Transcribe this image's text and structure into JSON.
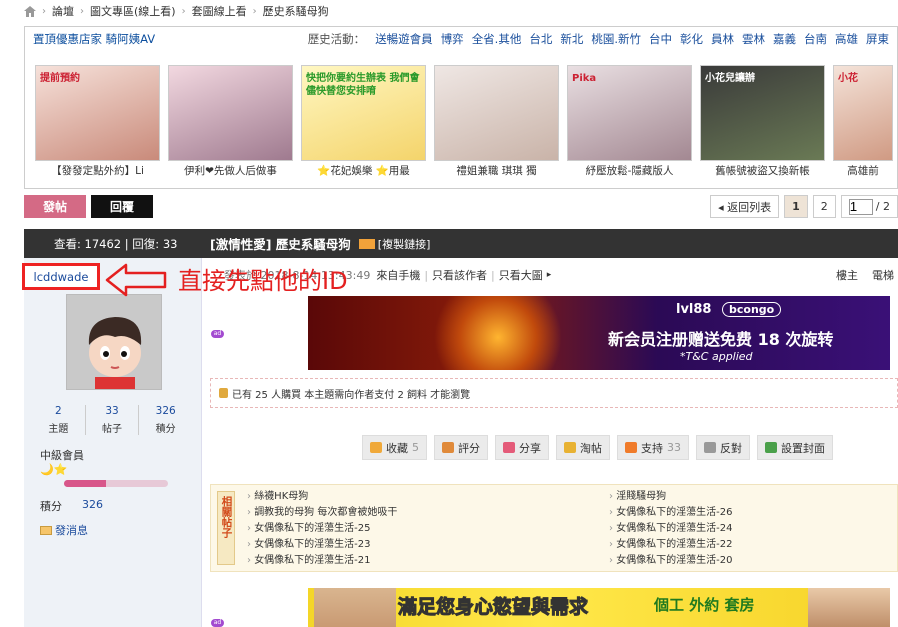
{
  "breadcrumb": {
    "items": [
      "論壇",
      "圖文專區(線上看)",
      "套圖線上看",
      "歷史系騷母狗"
    ]
  },
  "promo": {
    "left_label": "置頂優惠店家 騎阿姨AV",
    "activity_label": "歷史活動：",
    "links": [
      "送暢遊會員",
      "博弈",
      "全省.其他",
      "台北",
      "新北",
      "桃園.新竹",
      "台中",
      "彰化",
      "員林",
      "雲林",
      "嘉義",
      "台南",
      "高雄",
      "屏東"
    ],
    "thumbs": [
      {
        "caption": "【發發定點外約】Li",
        "img_text": "提前預約"
      },
      {
        "caption": "伊利❤先做人后做事",
        "img_text": ""
      },
      {
        "caption": "⭐花妃娛樂 ⭐用最",
        "img_text": "快把你要約生辦表 我們會儘快替您安排唷"
      },
      {
        "caption": "禮姐兼職 琪琪 獨",
        "img_text": ""
      },
      {
        "caption": "紓壓放鬆-隱藏版人",
        "img_text": "Pika"
      },
      {
        "caption": "舊帳號被盜又換新帳",
        "img_text": "小花兒讓辦"
      },
      {
        "caption": "高雄前",
        "img_text": "小花"
      }
    ]
  },
  "toolbar": {
    "post_label": "發帖",
    "reply_label": "回覆",
    "back_label": "◂ 返回列表",
    "pages": [
      "1",
      "2"
    ],
    "current_page": "1",
    "page_total": "/ 2"
  },
  "thread": {
    "stats": "查看: 17462 | 回復: 33",
    "title": "[激情性愛] 歷史系騷母狗",
    "copy_label": "[複製鏈接]"
  },
  "user": {
    "name": "lcddwade",
    "stats": [
      {
        "value": "2",
        "label": "主題"
      },
      {
        "value": "33",
        "label": "帖子"
      },
      {
        "value": "326",
        "label": "積分"
      }
    ],
    "level": "中級會員",
    "stars": "🌙⭐",
    "progress": 0.4,
    "points_label": "積分",
    "points_value": "326",
    "message_label": "發消息"
  },
  "annotation": {
    "text": "直接先點他的ID",
    "color": "#e42020"
  },
  "post_meta": {
    "hidden_text": "發表於 2018-8-14 13:43:49",
    "source": "來自手機",
    "only_author": "只看該作者",
    "only_image": "只看大圖",
    "floor_label": "樓主",
    "right_more": "電梯"
  },
  "banner1": {
    "logo": "lvl88",
    "logo_pill": "bcongo",
    "text": "新会员注册赠送免费 18 次旋转",
    "tc": "*T&C applied"
  },
  "purchase": {
    "text": "已有 25 人購買  本主題需向作者支付 2 飼料 才能瀏覽"
  },
  "actions": [
    {
      "icon": "star-icon",
      "label": "收藏",
      "count": "5",
      "color": "#f0a93a"
    },
    {
      "icon": "thumb-icon",
      "label": "評分",
      "count": "",
      "color": "#e08a3a"
    },
    {
      "icon": "heart-icon",
      "label": "分享",
      "count": "",
      "color": "#e45b79"
    },
    {
      "icon": "bucket-icon",
      "label": "淘帖",
      "count": "",
      "color": "#e8b233"
    },
    {
      "icon": "up-arrow-icon",
      "label": "支持",
      "count": "33",
      "color": "#f07b2a"
    },
    {
      "icon": "down-arrow-icon",
      "label": "反對",
      "count": "",
      "color": "#999999"
    },
    {
      "icon": "cover-icon",
      "label": "設置封面",
      "count": "",
      "color": "#4aa04a"
    }
  ],
  "related": {
    "tag": "相關帖子",
    "left": [
      "絲襪HK母狗",
      "調教我的母狗 每次都會被她吸干",
      "女偶像私下的淫蕩生活-25",
      "女偶像私下的淫蕩生活-23",
      "女偶像私下的淫蕩生活-21"
    ],
    "right": [
      "淫賤騷母狗",
      "女偶像私下的淫蕩生活-26",
      "女偶像私下的淫蕩生活-24",
      "女偶像私下的淫蕩生活-22",
      "女偶像私下的淫蕩生活-20"
    ]
  },
  "banner2": {
    "text1": "滿足您身心慾望與需求",
    "text2": "個工 外約 套房"
  }
}
